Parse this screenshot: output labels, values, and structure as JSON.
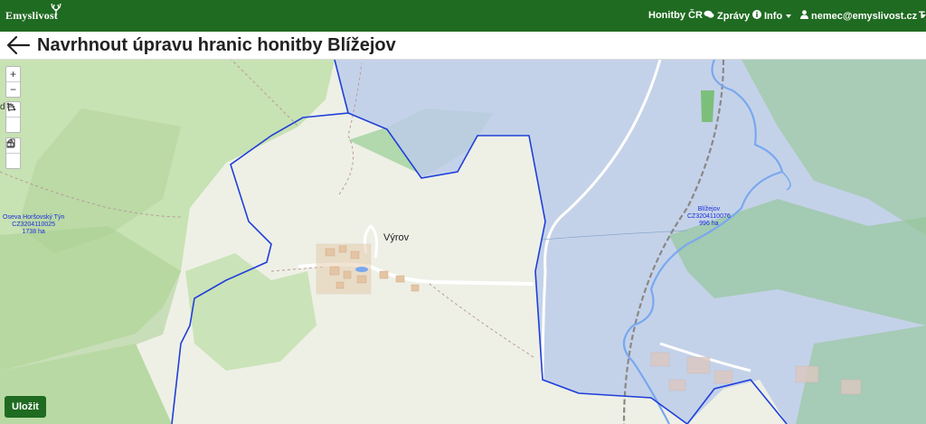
{
  "navbar": {
    "brand": "Emyslivost",
    "links": [
      {
        "label": "Honitby ČR",
        "icon": ""
      },
      {
        "label": "Zprávy",
        "icon": "chat-icon"
      },
      {
        "label": "Info",
        "icon": "info-icon"
      },
      {
        "label": "nemec@emyslivost.cz",
        "icon": "user-icon"
      }
    ],
    "cut_text": "T"
  },
  "page": {
    "title": "Navrhnout úpravu hranic honitby Blížejov"
  },
  "map": {
    "cut_label": "d",
    "place": "Výrov",
    "hunting_grounds": [
      {
        "name": "Oseva Horšovský Týn",
        "code": "CZ3204110025",
        "area": "1738 ha"
      },
      {
        "name": "Blížejov",
        "code": "CZ3204110076",
        "area": "996 ha"
      }
    ],
    "colors": {
      "forest": "#b8d9a4",
      "selected": "#c8d6ec",
      "boundary": "#1f3fd9",
      "water": "#7aa7ef"
    }
  },
  "controls": {
    "zoom_in": "+",
    "zoom_out": "−"
  },
  "save_label": "Uložit"
}
